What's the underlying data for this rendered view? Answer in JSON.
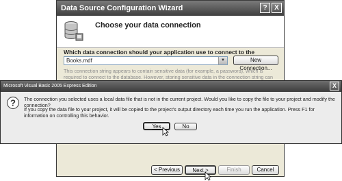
{
  "wizard": {
    "title": "Data Source Configuration Wizard",
    "help_glyph": "?",
    "close_glyph": "X",
    "heading": "Choose your data connection",
    "question": "Which data connection should your application use to connect to the database?",
    "selected_connection": "Books.mdf",
    "dropdown_glyph": "▼",
    "new_connection_label": "New Connection...",
    "connection_info": "This connection string appears to contain sensitive data (for example, a password), which is required to connect to the database. However, storing sensitive data in the connection string can be a security risk. Do you want to",
    "previous_label": "< Previous",
    "next_label": "Next >",
    "finish_label": "Finish",
    "cancel_label": "Cancel"
  },
  "dialog": {
    "title": "Microsoft Visual Basic 2005 Express Edition",
    "close_glyph": "X",
    "icon": "question-icon",
    "message1": "The connection you selected uses a local data file that is not in the current project. Would you like to copy the file to your project and modify the connection?",
    "message2": "If you copy the data file to your project, it will be copied to the project's output directory each time you run the application. Press F1 for information on controlling this behavior.",
    "yes_label": "Yes",
    "no_label": "No"
  }
}
